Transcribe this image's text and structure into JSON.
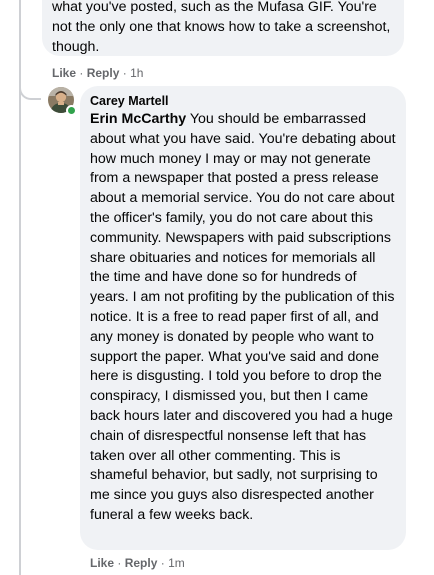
{
  "previous_comment": {
    "text": "what you've posted, such as the Mufasa GIF. You're not the only one that knows how to take a screenshot, though.",
    "actions": {
      "like": "Like",
      "reply": "Reply",
      "separator": "·",
      "time": "1h"
    }
  },
  "reply_comment": {
    "author": "Carey Martell",
    "mention": "Erin McCarthy",
    "text": " You should be embarrassed about what you have said. You're debating about how much money I may or may not generate from a newspaper that posted a press release about a memorial service. You do not care about the officer's family, you do not care about this community. Newspapers with paid subscriptions share obituaries and notices for memorials all the time and have done so for hundreds of years. I am not profiting by the publication of this notice. It is a free to read paper first of all, and any money is donated by people who want to support the paper. What you've said and done here is disgusting. I told you before to drop the conspiracy, I dismissed you, but then I came back hours later and discovered you had a huge chain of disrespectful nonsense left that has taken over all other commenting. This is shameful behavior, but sadly, not surprising to me since you guys also disrespected another funeral a few weeks back.",
    "online": true,
    "actions": {
      "like": "Like",
      "reply": "Reply",
      "separator": "·",
      "time": "1m"
    }
  },
  "colors": {
    "bubble_bg": "#f0f2f5",
    "text": "#050505",
    "meta_text": "#65676b",
    "thread_line": "#ced0d4",
    "online": "#31a24c"
  }
}
